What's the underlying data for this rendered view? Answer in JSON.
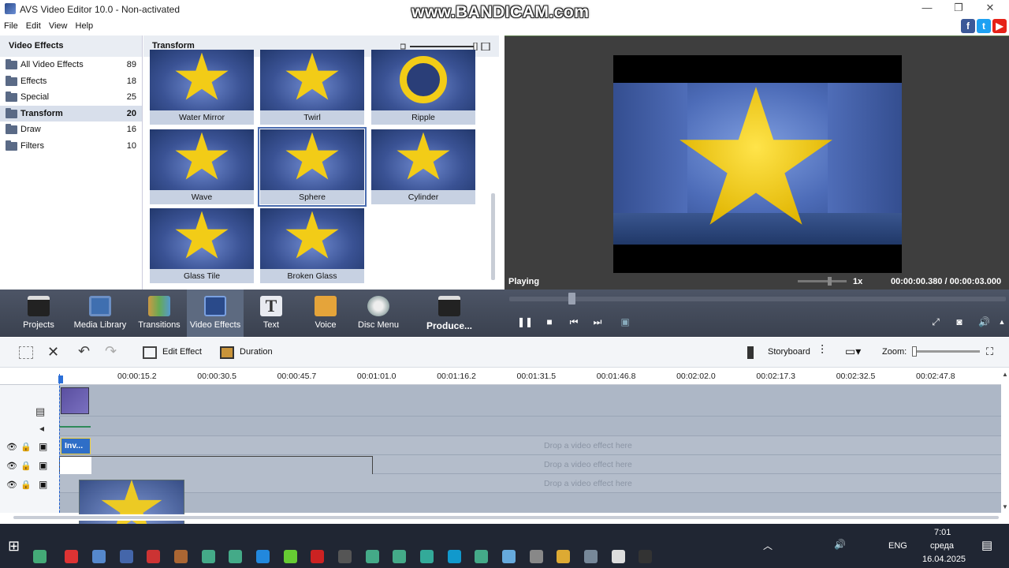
{
  "window": {
    "title": "AVS Video Editor 10.0 - Non-activated",
    "minimize": "—",
    "maximize": "❐",
    "close": "✕"
  },
  "watermark": "www.BANDICAM.com",
  "menu": [
    "File",
    "Edit",
    "View",
    "Help"
  ],
  "categories": {
    "header": "Video Effects",
    "items": [
      {
        "label": "All Video Effects",
        "count": "89"
      },
      {
        "label": "Effects",
        "count": "18"
      },
      {
        "label": "Special",
        "count": "25"
      },
      {
        "label": "Transform",
        "count": "20",
        "selected": true
      },
      {
        "label": "Draw",
        "count": "16"
      },
      {
        "label": "Filters",
        "count": "10"
      }
    ]
  },
  "effects": {
    "header": "Transform",
    "items": [
      "Water Mirror",
      "Twirl",
      "Ripple",
      "Wave",
      "Sphere",
      "Cylinder",
      "Glass Tile",
      "Broken Glass"
    ],
    "selected": "Sphere"
  },
  "preview": {
    "state": "Playing",
    "speed": "1x",
    "current_time": "00:00:00.380",
    "separator": "/",
    "total_time": "00:00:03.000"
  },
  "toolbar": [
    "Projects",
    "Media Library",
    "Transitions",
    "Video Effects",
    "Text",
    "Voice",
    "Disc Menu",
    "Produce..."
  ],
  "timeline_tools": {
    "edit_effect": "Edit Effect",
    "duration": "Duration",
    "storyboard": "Storyboard",
    "zoom": "Zoom:"
  },
  "ruler": [
    "00:00:15.2",
    "00:00:30.5",
    "00:00:45.7",
    "00:01:01.0",
    "00:01:16.2",
    "00:01:31.5",
    "00:01:46.8",
    "00:02:02.0",
    "00:02:17.3",
    "00:02:32.5",
    "00:02:47.8"
  ],
  "tracks": {
    "clip_label": "Inv...",
    "drop_hint": "Drop a video effect here"
  },
  "taskbar": {
    "time": "7:01",
    "day": "среда",
    "date": "16.04.2025",
    "lang": "ENG"
  },
  "colors": {
    "accent": "#4b6db0",
    "toolbar_bg": "#434a58",
    "star": "#f2cc17"
  }
}
